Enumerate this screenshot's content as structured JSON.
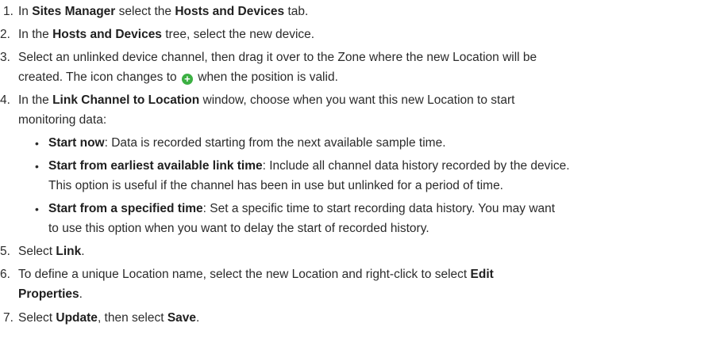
{
  "steps": [
    {
      "number": "1.",
      "parts": [
        "In ",
        "Sites Manager",
        " select the ",
        "Hosts and Devices",
        " tab."
      ]
    },
    {
      "number": "2.",
      "parts": [
        "In the ",
        "Hosts and Devices",
        " tree, select the new device."
      ]
    },
    {
      "number": "3.",
      "line1": "Select an unlinked device channel, then drag it over to the Zone where the new Location will be",
      "line2_before": "created. The icon changes to ",
      "icon": "plus-circle-icon",
      "line2_after": " when the position is valid."
    },
    {
      "number": "4.",
      "parts_line1": [
        "In the ",
        "Link Channel to Location",
        " window, choose when you want this new Location to start"
      ],
      "line2": "monitoring data:",
      "bullets": [
        {
          "term": "Start now",
          "desc": ": Data is recorded starting from the next available sample time."
        },
        {
          "term": "Start from earliest available link time",
          "desc": ": Include all channel data history recorded by the device.",
          "cont": "This option is useful if the channel has been in use but unlinked for a period of time."
        },
        {
          "term": "Start from a specified time",
          "desc": ": Set a specific time to start recording data history. You may want",
          "cont": "to use this option when you want to delay the start of recorded history."
        }
      ]
    },
    {
      "number": "5.",
      "parts": [
        "Select ",
        "Link",
        "."
      ]
    },
    {
      "number": "6.",
      "line1": "To define a unique Location name, select the new Location and right-click to select ",
      "line1_bold": "Edit",
      "line2_bold": "Properties",
      "line2_after": "."
    },
    {
      "number": "7.",
      "parts": [
        "Select ",
        "Update",
        ", then select ",
        "Save",
        "."
      ]
    }
  ],
  "colors": {
    "text": "#2b2b2b",
    "icon_green": "#3cb043"
  }
}
